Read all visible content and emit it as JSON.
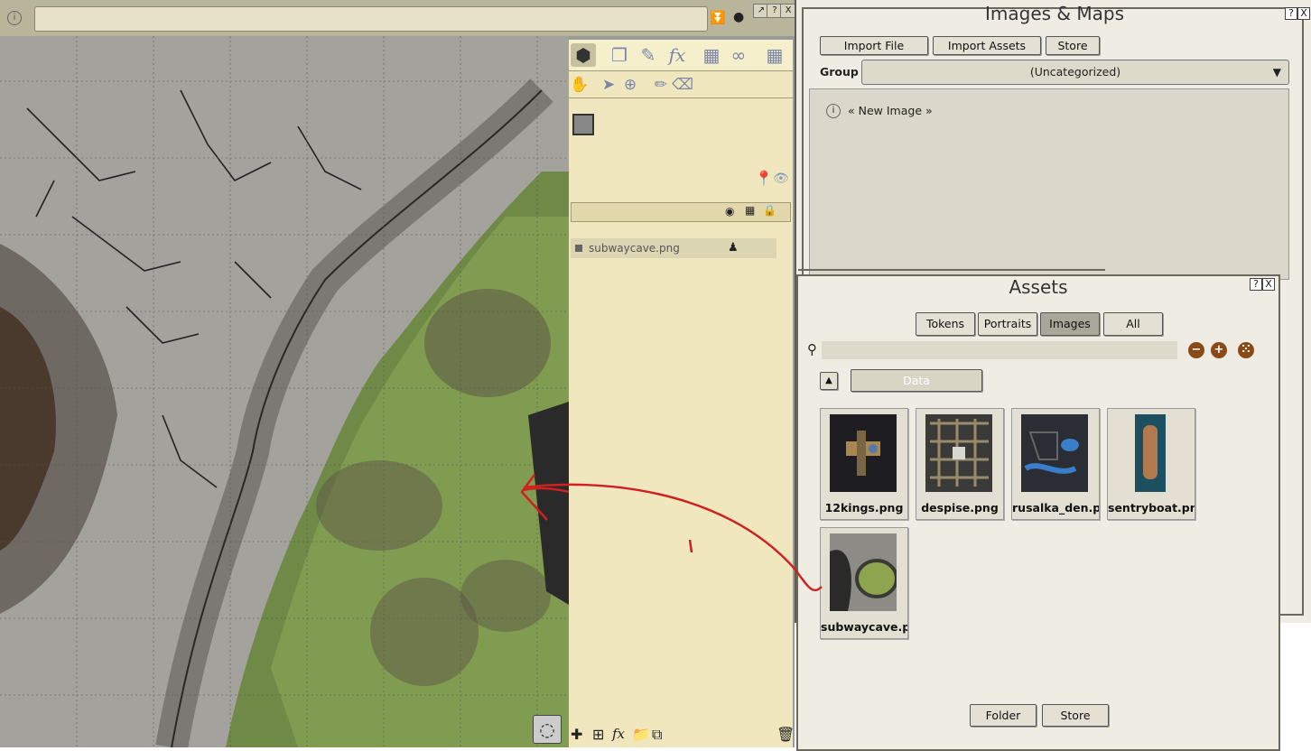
{
  "map_window": {
    "title_value": "",
    "layer_item": "subwaycave.png",
    "titlebar_buttons": [
      "?",
      "X"
    ]
  },
  "images_maps": {
    "title": "Images & Maps",
    "buttons": {
      "import_file": "Import File",
      "import_assets": "Import Assets",
      "store": "Store"
    },
    "group_label": "Group",
    "group_value": "(Uncategorized)",
    "new_image": "« New Image »",
    "help": "?",
    "close": "X"
  },
  "assets": {
    "title": "Assets",
    "help": "?",
    "close": "X",
    "tabs": {
      "tokens": "Tokens",
      "portraits": "Portraits",
      "images": "Images",
      "all": "All"
    },
    "search_placeholder": "",
    "folder_path": "Data",
    "items": [
      {
        "label": "12kings.png"
      },
      {
        "label": "despise.png"
      },
      {
        "label": "rusalka_den.p"
      },
      {
        "label": "sentryboat.pn"
      },
      {
        "label": "subwaycave.p"
      }
    ],
    "footer": {
      "folder": "Folder",
      "store": "Store"
    },
    "colors": {
      "round_btn": "#c26a1e",
      "selected_tab": "#a9a69a"
    }
  }
}
